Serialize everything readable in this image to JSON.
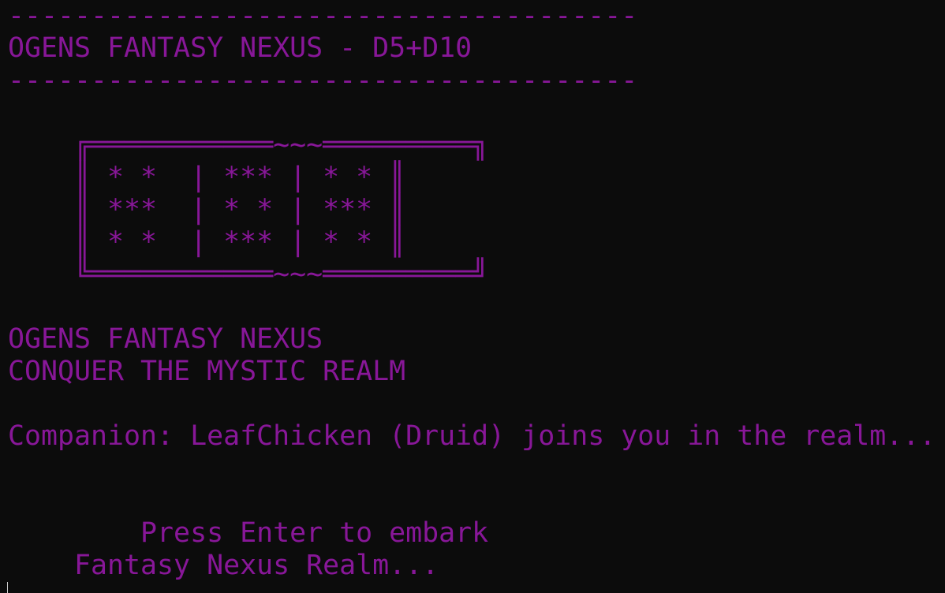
{
  "colors": {
    "background": "#0c0c0c",
    "text": "#881798",
    "cursor": "#cccccc"
  },
  "terminal": {
    "lines": [
      "--------------------------------------",
      "OGENS FANTASY NEXUS - D5+D10",
      "--------------------------------------",
      "",
      "    ╔═══════════~~~═════════╗",
      "    ║ * *  | *** | * * ║",
      "    ║ ***  | * * | *** ║",
      "    ║ * *  | *** | * * ║",
      "    ╚═══════════~~~═════════╝",
      "",
      "OGENS FANTASY NEXUS",
      "CONQUER THE MYSTIC REALM",
      "",
      "Companion: LeafChicken (Druid) joins you in the realm...",
      "",
      "",
      "        Press Enter to embark",
      "    Fantasy Nexus Realm..."
    ]
  }
}
